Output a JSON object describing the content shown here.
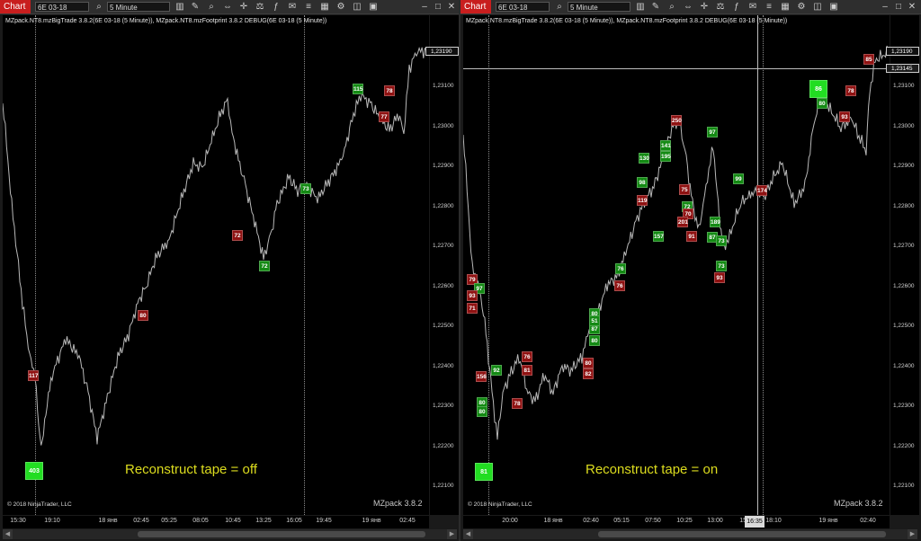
{
  "left": {
    "toolbar": {
      "chart_label": "Chart",
      "instrument": "6E 03-18",
      "interval": "5 Minute"
    },
    "title": "MZpack.NT8.mzBigTrade 3.8.2(6E 03-18 (5 Minute)), MZpack.NT8.mzFootprint 3.8.2 DEBUG(6E 03-18 (5 Minute))",
    "price_ticks": [
      "1,23100",
      "1,23000",
      "1,22900",
      "1,22800",
      "1,22700",
      "1,22600",
      "1,22500",
      "1,22400",
      "1,22300",
      "1,22200",
      "1,22100"
    ],
    "last_price": "1,23190",
    "time_ticks": [
      "15:30",
      "19:10",
      "18 янв",
      "02:45",
      "05:25",
      "08:05",
      "10:45",
      "13:25",
      "16:05",
      "19:45",
      "19 янв",
      "02:45"
    ],
    "markers": [
      {
        "v": "115",
        "t": "buy"
      },
      {
        "v": "78",
        "t": "sell"
      },
      {
        "v": "77",
        "t": "sell"
      },
      {
        "v": "73",
        "t": "buy"
      },
      {
        "v": "72",
        "t": "sell"
      },
      {
        "v": "72",
        "t": "buy"
      },
      {
        "v": "80",
        "t": "sell"
      },
      {
        "v": "117",
        "t": "sell"
      },
      {
        "v": "403",
        "t": "big"
      }
    ],
    "annotation": "Reconstruct tape = off",
    "copyright": "© 2018 NinjaTrader, LLC",
    "watermark": "MZpack 3.8.2"
  },
  "right": {
    "toolbar": {
      "chart_label": "Chart",
      "instrument": "6E 03-18",
      "interval": "5 Minute"
    },
    "title": "MZpack.NT8.mzBigTrade 3.8.2(6E 03-18 (5 Minute)), MZpack.NT8.mzFootprint 3.8.2 DEBUG(6E 03-18 (5 Minute))",
    "price_ticks": [
      "1,23100",
      "1,23000",
      "1,22900",
      "1,22800",
      "1,22700",
      "1,22600",
      "1,22500",
      "1,22400",
      "1,22300",
      "1,22200",
      "1,22100"
    ],
    "last_price": "1,23190",
    "cross_price": "1,23145",
    "cross_time": "16:35",
    "time_ticks": [
      "20:00",
      "18 янв",
      "02:40",
      "05:15",
      "07:50",
      "10:25",
      "13:00",
      "15:35",
      "18:10",
      "19 янв",
      "02:40"
    ],
    "markers": [
      {
        "v": "85",
        "t": "sell"
      },
      {
        "v": "86",
        "t": "big"
      },
      {
        "v": "78",
        "t": "sell"
      },
      {
        "v": "80",
        "t": "buy"
      },
      {
        "v": "93",
        "t": "sell"
      },
      {
        "v": "250",
        "t": "sell"
      },
      {
        "v": "97",
        "t": "buy"
      },
      {
        "v": "141",
        "t": "buy"
      },
      {
        "v": "195",
        "t": "buy"
      },
      {
        "v": "130",
        "t": "buy"
      },
      {
        "v": "98",
        "t": "buy"
      },
      {
        "v": "119",
        "t": "sell"
      },
      {
        "v": "75",
        "t": "sell"
      },
      {
        "v": "72",
        "t": "buy"
      },
      {
        "v": "70",
        "t": "sell"
      },
      {
        "v": "201",
        "t": "sell"
      },
      {
        "v": "189",
        "t": "buy"
      },
      {
        "v": "157",
        "t": "buy"
      },
      {
        "v": "91",
        "t": "sell"
      },
      {
        "v": "87",
        "t": "buy"
      },
      {
        "v": "73",
        "t": "buy"
      },
      {
        "v": "76",
        "t": "buy"
      },
      {
        "v": "73",
        "t": "buy"
      },
      {
        "v": "93",
        "t": "sell"
      },
      {
        "v": "99",
        "t": "buy"
      },
      {
        "v": "174",
        "t": "sell"
      },
      {
        "v": "76",
        "t": "sell"
      },
      {
        "v": "80",
        "t": "buy"
      },
      {
        "v": "87",
        "t": "buy"
      },
      {
        "v": "51",
        "t": "buy"
      },
      {
        "v": "80",
        "t": "buy"
      },
      {
        "v": "79",
        "t": "sell"
      },
      {
        "v": "97",
        "t": "buy"
      },
      {
        "v": "93",
        "t": "sell"
      },
      {
        "v": "71",
        "t": "sell"
      },
      {
        "v": "76",
        "t": "sell"
      },
      {
        "v": "81",
        "t": "sell"
      },
      {
        "v": "80",
        "t": "sell"
      },
      {
        "v": "82",
        "t": "sell"
      },
      {
        "v": "156",
        "t": "sell"
      },
      {
        "v": "92",
        "t": "buy"
      },
      {
        "v": "80",
        "t": "buy"
      },
      {
        "v": "80",
        "t": "buy"
      },
      {
        "v": "78",
        "t": "sell"
      },
      {
        "v": "81",
        "t": "big"
      }
    ],
    "annotation": "Reconstruct tape = on",
    "copyright": "© 2018 NinjaTrader, LLC",
    "watermark": "MZpack 3.8.2"
  },
  "colors": {
    "sell": "#8f1212",
    "buy": "#148a14",
    "big": "#22dd22",
    "annotation": "#dcdc1e",
    "chart_tab": "#c81e1e"
  }
}
